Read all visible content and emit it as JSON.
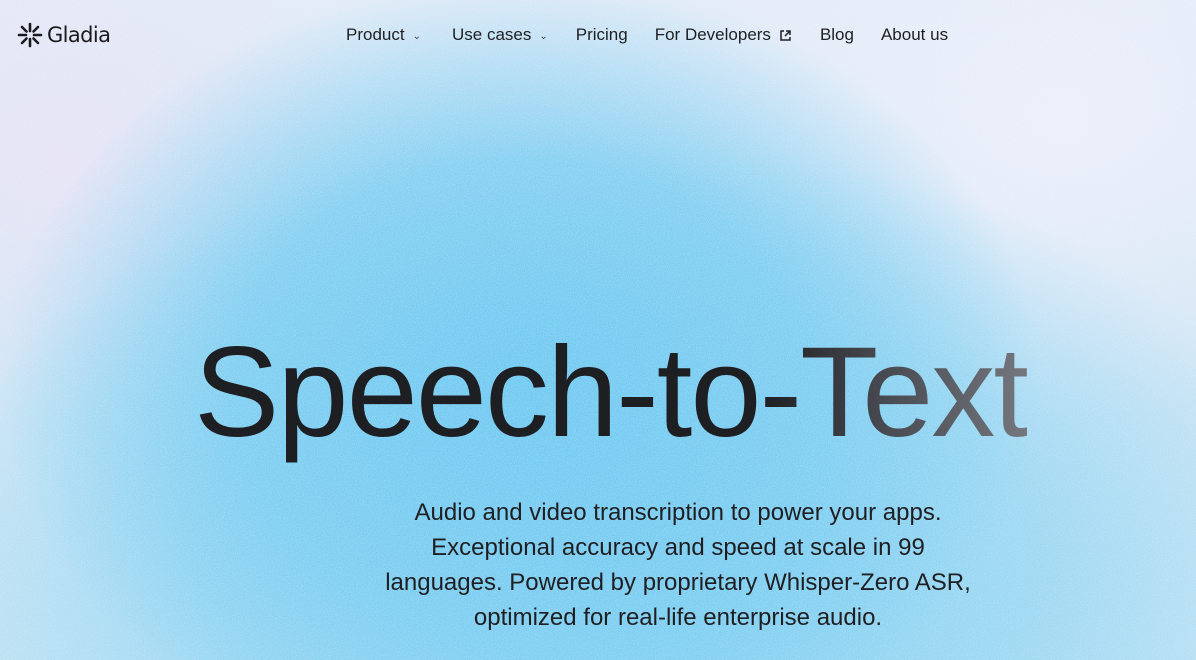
{
  "brand": {
    "name": "Gladia",
    "icon": "gladia-logo-icon"
  },
  "nav": {
    "items": [
      {
        "label": "Product",
        "icon": "chevron-down-icon"
      },
      {
        "label": "Use cases",
        "icon": "chevron-down-icon"
      },
      {
        "label": "Pricing"
      },
      {
        "label": "For Developers",
        "icon": "external-link-icon"
      },
      {
        "label": "Blog"
      },
      {
        "label": "About us"
      }
    ]
  },
  "hero": {
    "title": "Speech-to-Text",
    "subtitle_lines": [
      "Audio and video transcription to power your apps.",
      "Exceptional accuracy and speed at scale in 99",
      "languages. Powered by proprietary Whisper-Zero ASR,",
      "optimized for real-life enterprise audio."
    ]
  },
  "colors": {
    "text": "#1c1c1e",
    "background_blue": "#6ec8f0",
    "background_light": "#dfe9f6"
  }
}
